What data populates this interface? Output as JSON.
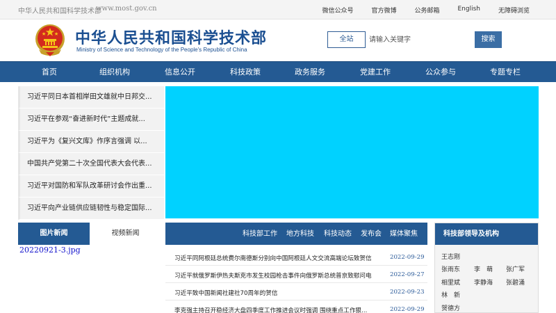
{
  "topbar": {
    "org_name": "中华人民共和国科学技术部",
    "url": "www.most.gov.cn",
    "links": [
      "微信公众号",
      "官方微博",
      "公务邮箱",
      "English",
      "无障碍浏览"
    ]
  },
  "header": {
    "title": "中华人民共和国科学技术部",
    "subtitle": "Ministry of Science and Technology of the People's Republic of China",
    "search_scope": "全站",
    "search_placeholder": "请输入关键字",
    "search_button": "搜索"
  },
  "nav": {
    "items": [
      "首页",
      "组织机构",
      "信息公开",
      "科技政策",
      "政务服务",
      "党建工作",
      "公众参与",
      "专题专栏"
    ]
  },
  "headlines": [
    "习近平同日本首相岸田文雄就中日邦交...",
    "习近平在参观“奋进新时代”主题成就...",
    "习近平为《复兴文库》作序言强调 以...",
    "中国共产党第二十次全国代表大会代表...",
    "习近平对国防和军队改革研讨会作出重...",
    "习近平向产业链供应链韧性与稳定国际..."
  ],
  "media": {
    "tabs": [
      "图片新闻",
      "视频新闻"
    ],
    "image_link": "20220921-3.jpg"
  },
  "news": {
    "tabs": [
      "科技部工作",
      "地方科技",
      "科技动态",
      "发布会",
      "媒体聚焦"
    ],
    "items": [
      {
        "title": "习近平同阿根廷总统费尔南德斯分别向中国阿根廷人文交流高端论坛致贺信",
        "date": "2022-09-29"
      },
      {
        "title": "习近平就俄罗斯伊热夫斯克市发生校园枪击事件向俄罗斯总统普京致慰问电",
        "date": "2022-09-27"
      },
      {
        "title": "习近平致中国新闻社建社70周年的贺信",
        "date": "2022-09-23"
      },
      {
        "title": "李克强主持召开稳经济大盘四季度工作推进会议时强调 围绕重点工作狠...",
        "date": "2022-09-29"
      }
    ]
  },
  "leaders": {
    "title": "科技部领导及机构",
    "names": [
      "王志刚",
      "张雨东",
      "李　萌",
      "张广军",
      "相里斌",
      "李静海",
      "张碧涌",
      "林　新",
      "贺德方"
    ]
  },
  "colors": {
    "brand_blue": "#245a93",
    "title_blue": "#1b4f91",
    "banner_cyan": "#00d2ff"
  }
}
